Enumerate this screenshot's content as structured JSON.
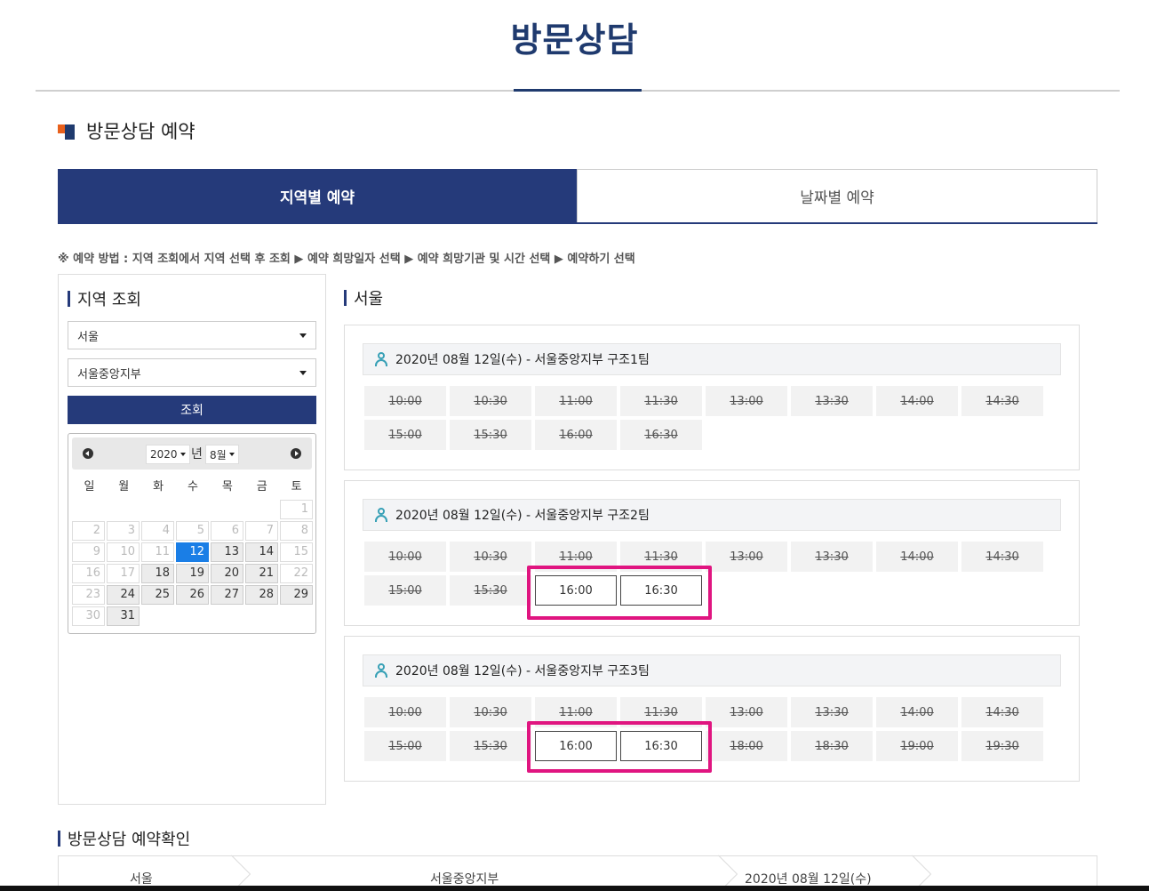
{
  "page": {
    "title": "방문상담"
  },
  "section": {
    "title": "방문상담 예약"
  },
  "tabs": [
    {
      "label": "지역별 예약",
      "active": true
    },
    {
      "label": "날짜별 예약",
      "active": false
    }
  ],
  "guide": "※ 예약 방법 : 지역 조회에서 지역 선택 후 조회 ▶ 예약 희망일자 선택 ▶ 예약 희망기관 및 시간 선택 ▶ 예약하기 선택",
  "region_search": {
    "title": "지역 조회",
    "region_value": "서울",
    "branch_value": "서울중앙지부",
    "search_button": "조회"
  },
  "calendar": {
    "year": "2020",
    "year_unit": "년",
    "month": "8월",
    "weekdays": [
      "일",
      "월",
      "화",
      "수",
      "목",
      "금",
      "토"
    ],
    "selected_day": 12,
    "available_days": [
      12,
      13,
      14,
      18,
      19,
      20,
      21,
      24,
      25,
      26,
      27,
      28,
      29,
      31
    ]
  },
  "results": {
    "region_title": "서울",
    "teams": [
      {
        "header": "2020년 08월 12일(수) - 서울중앙지부 구조1팀",
        "slots": [
          {
            "time": "10:00",
            "available": false
          },
          {
            "time": "10:30",
            "available": false
          },
          {
            "time": "11:00",
            "available": false
          },
          {
            "time": "11:30",
            "available": false
          },
          {
            "time": "13:00",
            "available": false
          },
          {
            "time": "13:30",
            "available": false
          },
          {
            "time": "14:00",
            "available": false
          },
          {
            "time": "14:30",
            "available": false
          },
          {
            "time": "15:00",
            "available": false
          },
          {
            "time": "15:30",
            "available": false
          },
          {
            "time": "16:00",
            "available": false
          },
          {
            "time": "16:30",
            "available": false
          }
        ]
      },
      {
        "header": "2020년 08월 12일(수) - 서울중앙지부 구조2팀",
        "slots": [
          {
            "time": "10:00",
            "available": false
          },
          {
            "time": "10:30",
            "available": false
          },
          {
            "time": "11:00",
            "available": false
          },
          {
            "time": "11:30",
            "available": false
          },
          {
            "time": "13:00",
            "available": false
          },
          {
            "time": "13:30",
            "available": false
          },
          {
            "time": "14:00",
            "available": false
          },
          {
            "time": "14:30",
            "available": false
          },
          {
            "time": "15:00",
            "available": false
          },
          {
            "time": "15:30",
            "available": false
          },
          {
            "time": "16:00",
            "available": true
          },
          {
            "time": "16:30",
            "available": true
          }
        ]
      },
      {
        "header": "2020년 08월 12일(수) - 서울중앙지부 구조3팀",
        "slots": [
          {
            "time": "10:00",
            "available": false
          },
          {
            "time": "10:30",
            "available": false
          },
          {
            "time": "11:00",
            "available": false
          },
          {
            "time": "11:30",
            "available": false
          },
          {
            "time": "13:00",
            "available": false
          },
          {
            "time": "13:30",
            "available": false
          },
          {
            "time": "14:00",
            "available": false
          },
          {
            "time": "14:30",
            "available": false
          },
          {
            "time": "15:00",
            "available": false
          },
          {
            "time": "15:30",
            "available": false
          },
          {
            "time": "16:00",
            "available": true
          },
          {
            "time": "16:30",
            "available": true
          },
          {
            "time": "18:00",
            "available": false
          },
          {
            "time": "18:30",
            "available": false
          },
          {
            "time": "19:00",
            "available": false
          },
          {
            "time": "19:30",
            "available": false
          }
        ]
      }
    ]
  },
  "confirm": {
    "title": "방문상담 예약확인",
    "region": "서울",
    "branch": "서울중앙지부",
    "date": "2020년 08월 12일(수)"
  },
  "colors": {
    "primary_navy": "#253a7a",
    "title_navy": "#1f3a6e",
    "accent_orange": "#e8601c",
    "calendar_selected": "#1a7ee6",
    "highlight_pink": "#e01580"
  }
}
